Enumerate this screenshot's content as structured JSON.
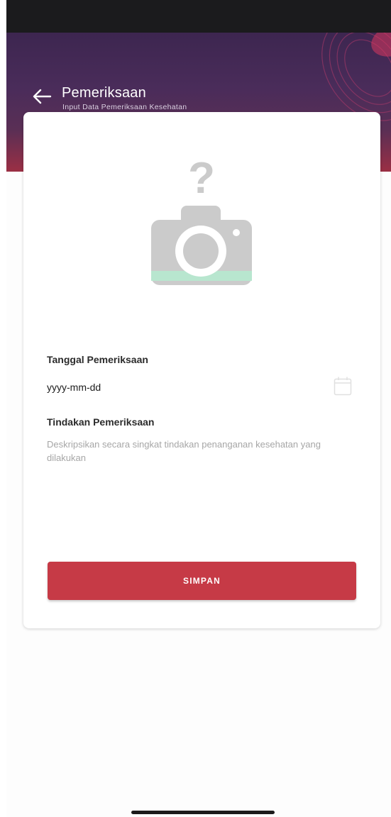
{
  "header": {
    "title": "Pemeriksaan",
    "subtitle": "Input Data Pemeriksaan Kesehatan",
    "back_icon": "arrow-left-icon"
  },
  "form": {
    "photo_icon": "camera-question-icon",
    "date_label": "Tanggal Pemeriksaan",
    "date_placeholder": "yyyy-mm-dd",
    "date_icon": "calendar-icon",
    "description_label": "Tindakan Pemeriksaan",
    "description_placeholder": "Deskripsikan secara singkat tindakan penanganan kesehatan yang dilakukan",
    "description_value": "",
    "save_label": "SIMPAN"
  },
  "colors": {
    "header_top": "#3d2650",
    "header_bottom": "#9b2f44",
    "primary_button": "#c63a46",
    "photo_icon_gray": "#cbcbcb",
    "photo_icon_accent": "#b8e6cf"
  }
}
